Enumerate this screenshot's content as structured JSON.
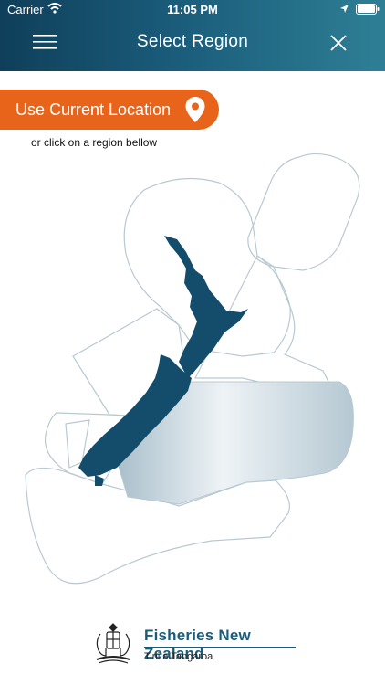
{
  "status": {
    "carrier": "Carrier",
    "time": "11:05 PM"
  },
  "header": {
    "title": "Select Region"
  },
  "location_button": {
    "label": "Use Current Location"
  },
  "hint": "or click on a region bellow",
  "map": {
    "colors": {
      "land": "#134d6b",
      "region_stroke": "#b8c9d2",
      "selected_fill": "#b9ccd6",
      "accent": "#e8641b"
    },
    "selected_region": "east-coast-south-island"
  },
  "logo": {
    "name": "Fisheries New Zealand",
    "subtitle": "Tini a Tangaroa"
  },
  "icons": [
    "menu-icon",
    "close-icon",
    "wifi-icon",
    "location-arrow-icon",
    "battery-icon",
    "location-pin-icon",
    "coat-of-arms-icon"
  ]
}
